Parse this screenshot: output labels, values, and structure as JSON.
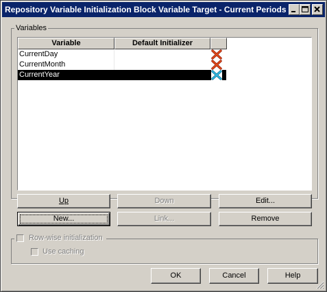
{
  "window": {
    "title": "Repository Variable Initialization Block Variable Target - Current Periods",
    "minimize_icon": "minimize-icon",
    "maximize_icon": "maximize-icon",
    "close_icon": "close-icon"
  },
  "variables_group": {
    "label": "Variables",
    "columns": [
      "Variable",
      "Default Initializer"
    ],
    "rows": [
      {
        "variable": "CurrentDay",
        "default_initializer": "",
        "delete_icon": "red-x-delete-icon"
      },
      {
        "variable": "CurrentMonth",
        "default_initializer": "",
        "delete_icon": "red-x-delete-icon"
      },
      {
        "variable": "CurrentYear",
        "default_initializer": "",
        "delete_icon": "blue-x-delete-icon",
        "selected": true
      }
    ],
    "colors": {
      "delete_red": "#d03010",
      "delete_blue": "#20a8d8",
      "selection": "#000000"
    }
  },
  "buttons": {
    "up": "Up",
    "down": "Down",
    "edit": "Edit...",
    "new": "New...",
    "link": "Link...",
    "remove": "Remove"
  },
  "rowwise": {
    "label": "Row-wise initialization",
    "use_caching": "Use caching"
  },
  "footer": {
    "ok": "OK",
    "cancel": "Cancel",
    "help": "Help"
  }
}
